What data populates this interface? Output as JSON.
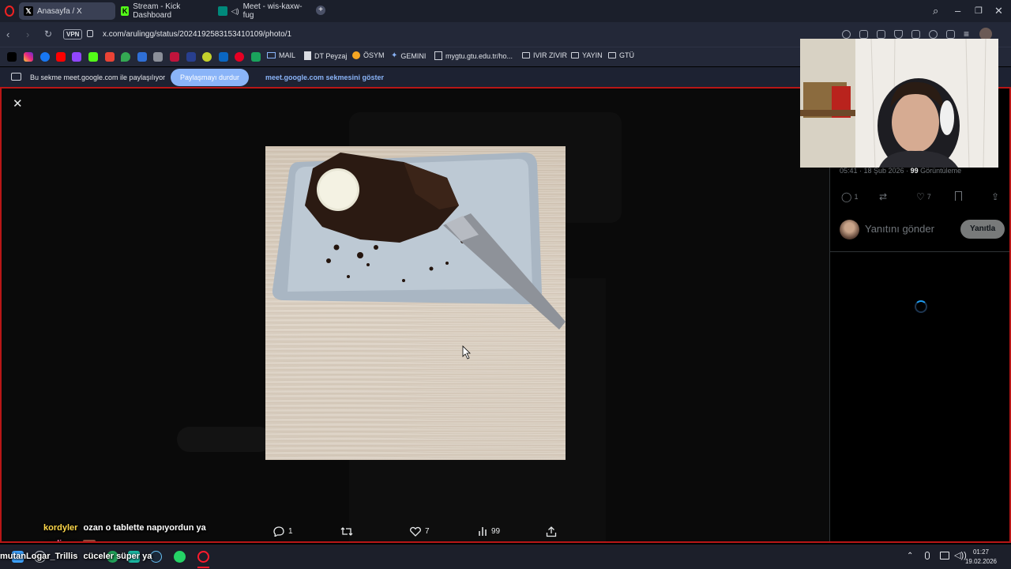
{
  "tabs": [
    {
      "label": "Anasayfa / X",
      "active": true
    },
    {
      "label": "Stream - Kick Dashboard",
      "active": false
    },
    {
      "label": "Meet - wis-kaxw-fug",
      "active": false
    }
  ],
  "address": {
    "vpn": "VPN",
    "url": "x.com/arulingg/status/2024192583153410109/photo/1"
  },
  "bookmarks": {
    "mail": "MAIL",
    "dt_peyzaj": "DT Peyzaj",
    "osym": "ÖSYM",
    "gemini": "GEMINI",
    "mygtu": "mygtu.gtu.edu.tr/ho...",
    "ivir_zivir": "IVIR ZIVIR",
    "yayin": "YAYIN",
    "gtu": "GTÜ"
  },
  "sharebar": {
    "text": "Bu sekme meet.google.com ile paylaşılıyor",
    "stop_label": "Paylaşmayı durdur",
    "show_label": "meet.google.com sekmesini göster"
  },
  "photo_actions": {
    "replies": "1",
    "likes": "7",
    "views": "99"
  },
  "right_panel": {
    "time": "05:41 · 18 Şub 2026 · ",
    "views_count": "99",
    "views_label": " Görüntüleme",
    "replies": "1",
    "likes": "7",
    "reply_placeholder": "Yanıtını gönder",
    "reply_button": "Yanıtla"
  },
  "chat": [
    {
      "user": "kordyler",
      "message": "ozan o tablette napıyordun ya",
      "user_color": "#ffd84a"
    },
    {
      "user": "arulingg",
      "message": "",
      "user_color": "#ff6fa8"
    },
    {
      "user": "mutanLogar_Trillis",
      "message": "cüceler süper ya",
      "user_color": "#ffffff"
    }
  ],
  "clock": {
    "time": "01:27",
    "date": "19.02.2026"
  },
  "colors": {
    "accent_blue": "#1d9bf0",
    "share_border": "#b81616"
  }
}
